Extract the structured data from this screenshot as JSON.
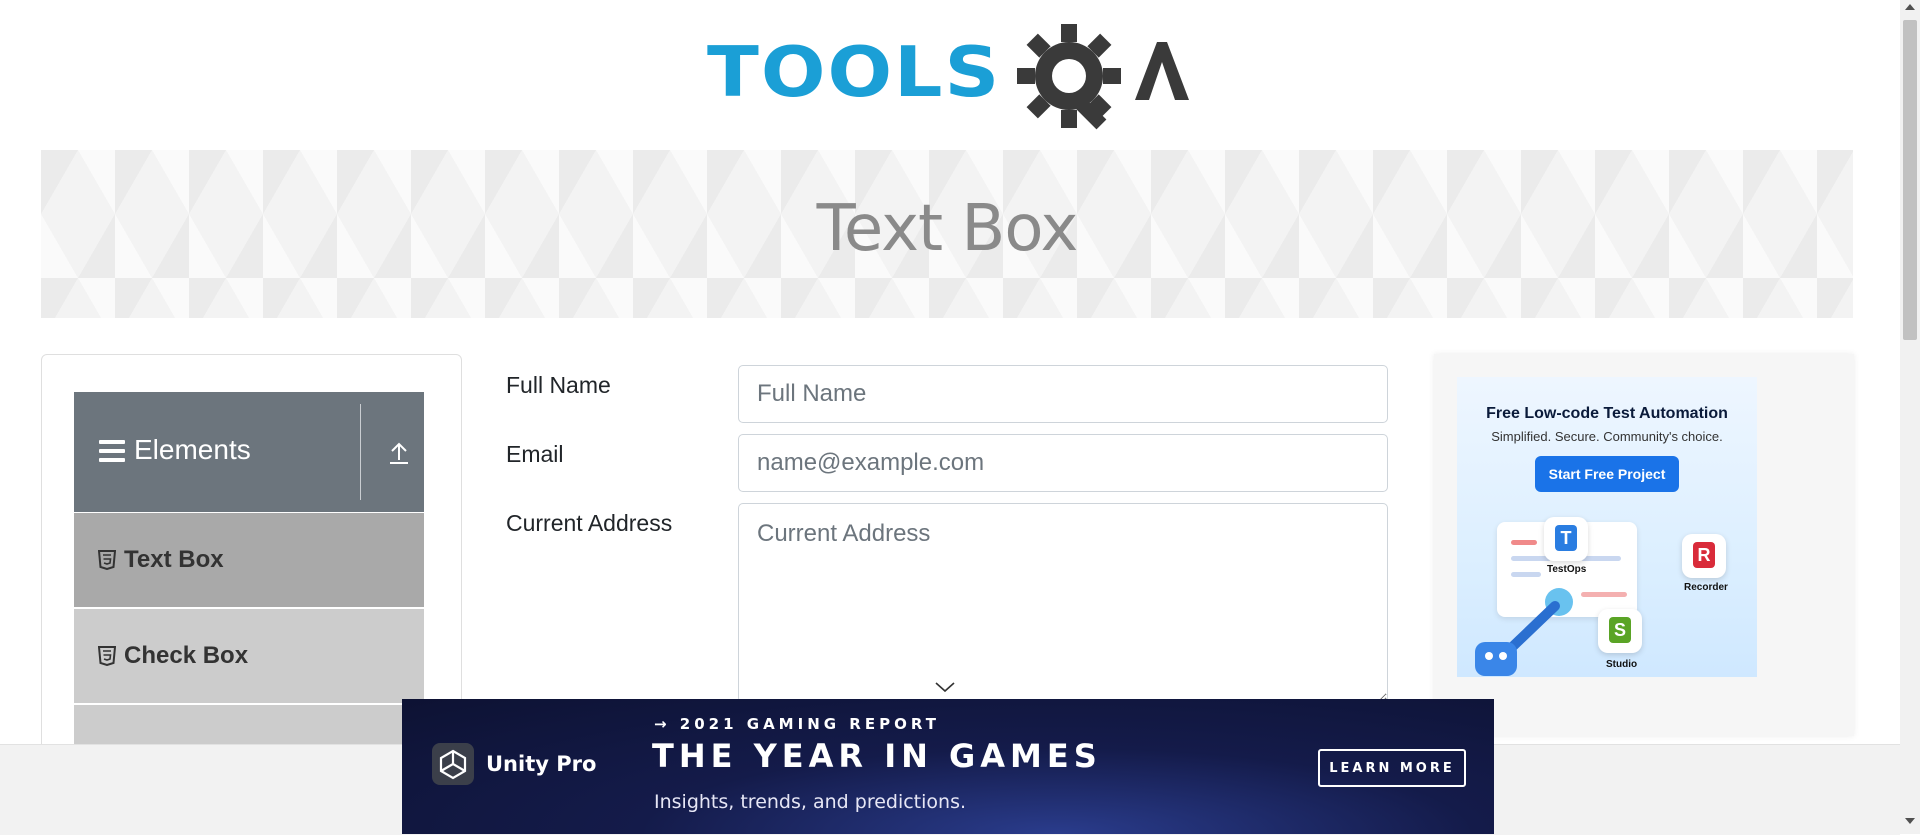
{
  "header": {
    "logo_text": "TOOLSQA",
    "logo_word": "TOOLS"
  },
  "banner": {
    "title": "Text Box"
  },
  "sidebar": {
    "group_title": "Elements",
    "items": [
      {
        "label": "Text Box",
        "active": true
      },
      {
        "label": "Check Box",
        "active": false
      }
    ]
  },
  "form": {
    "full_name": {
      "label": "Full Name",
      "placeholder": "Full Name"
    },
    "email": {
      "label": "Email",
      "placeholder": "name@example.com"
    },
    "current_address": {
      "label": "Current Address",
      "placeholder": "Current Address"
    }
  },
  "right_ad": {
    "headline": "Free Low-code Test Automation",
    "subline": "Simplified. Secure. Community's choice.",
    "button": "Start Free Project",
    "tiles": [
      {
        "letter": "T",
        "caption": "TestOps",
        "color": "#2a7de1"
      },
      {
        "letter": "R",
        "caption": "Recorder",
        "color": "#d92b3a"
      },
      {
        "letter": "S",
        "caption": "Studio",
        "color": "#5aa426"
      }
    ]
  },
  "bottom_ad": {
    "brand": "Unity Pro",
    "kicker": "→ 2021 GAMING REPORT",
    "headline": "THE YEAR IN GAMES",
    "subline": "Insights, trends, and predictions.",
    "cta": "LEARN MORE"
  },
  "colors": {
    "logo_blue": "#1b9fd6",
    "logo_dark": "#3a3a3a",
    "group_header_bg": "#6c757d",
    "active_item_bg": "#a9a9a9",
    "item_bg": "#cccccc"
  }
}
